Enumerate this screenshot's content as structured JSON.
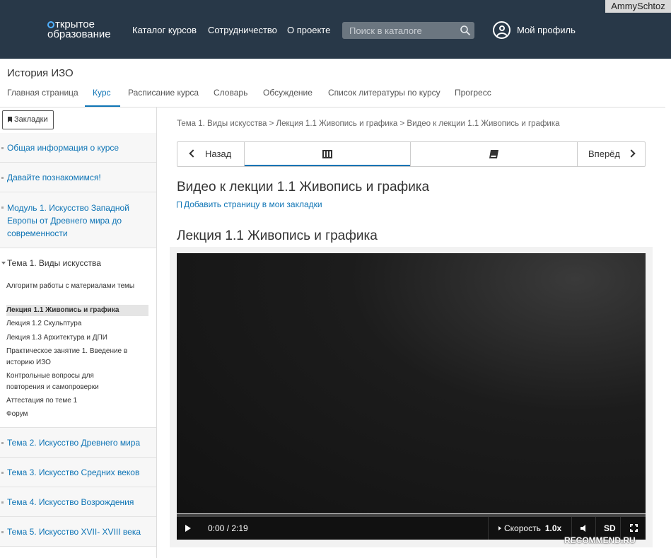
{
  "header": {
    "logo_line1": "ткрытое",
    "logo_line2": "образование",
    "nav": [
      "Каталог курсов",
      "Сотрудничество",
      "О проекте"
    ],
    "search_placeholder": "Поиск в каталоге",
    "profile_label": "Мой профиль",
    "watermark_user": "AmmySchtoz"
  },
  "course": {
    "title": "История ИЗО",
    "tabs": [
      "Главная страница",
      "Курс",
      "Расписание курса",
      "Словарь",
      "Обсуждение",
      "Список литературы по курсу",
      "Прогресс"
    ],
    "active_tab": "Курс"
  },
  "sidebar": {
    "bookmarks_button": "Закладки",
    "sections_top": [
      "Общая информация о курсе",
      "Давайте познакомимся!",
      "Модуль 1. Искусство Западной Европы от Древнего мира до современности"
    ],
    "open_topic": "Тема 1. Виды искусства",
    "subsections": [
      "Алгоритм работы с материалами темы",
      "Лекция 1.1 Живопись и графика",
      "Лекция 1.2 Скульптура",
      "Лекция 1.3 Архитектура и ДПИ",
      "Практическое занятие 1. Введение в историю ИЗО",
      "Контрольные вопросы для повторения и самопроверки",
      "Аттестация по теме 1",
      "Форум"
    ],
    "active_subsection": "Лекция 1.1 Живопись и графика",
    "sections_bottom": [
      "Тема 2. Искусство Древнего мира",
      "Тема 3. Искусство Средних веков",
      "Тема 4. Искусство Возрождения",
      "Тема 5. Искусство XVII- XVIII века"
    ]
  },
  "main": {
    "breadcrumb": "Тема 1. Виды искусства > Лекция 1.1 Живопись и графика > Видео к лекции 1.1 Живопись и графика",
    "prev_label": "Назад",
    "next_label": "Вперёд",
    "unit_title": "Видео к лекции 1.1 Живопись и графика",
    "add_bookmark": "Добавить страницу в мои закладки",
    "lecture_title": "Лекция 1.1 Живопись и графика"
  },
  "player": {
    "time": "0:00 / 2:19",
    "speed_label": "Скорость",
    "speed_value": "1.0x",
    "quality": "SD",
    "progress": 0
  },
  "watermark": "RECOMMEND.RU",
  "colors": {
    "header_bg": "#283848",
    "link": "#0e74b5",
    "video_bg": "#161616"
  }
}
